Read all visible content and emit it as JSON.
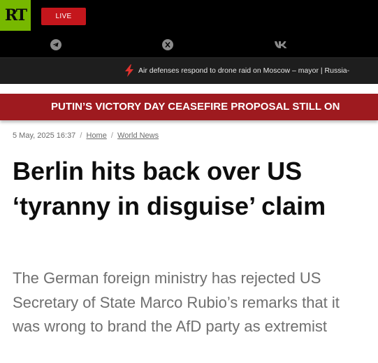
{
  "header": {
    "logo_text": "RT",
    "live_label": "LIVE",
    "social_icons": [
      "telegram-icon",
      "x-icon",
      "vk-icon"
    ]
  },
  "ticker": {
    "icon": "lightning-icon",
    "text": "Air defenses respond to drone raid on Moscow – mayor | Russia-"
  },
  "banner": {
    "text": "PUTIN’S VICTORY DAY CEASEFIRE PROPOSAL STILL ON"
  },
  "article": {
    "date": "5 May, 2025 16:37",
    "breadcrumb": [
      "Home",
      "World News"
    ],
    "title": "Berlin hits back over US ‘tyranny in disguise’ claim",
    "summary": "The German foreign ministry has rejected US Secretary of State Marco Rubio’s remarks that it was wrong to brand the AfD party as extremist"
  },
  "colors": {
    "brand_green": "#77b800",
    "live_red": "#c4161c",
    "banner_red": "#9e1a1f",
    "ticker_bg": "#1e1e1e"
  }
}
